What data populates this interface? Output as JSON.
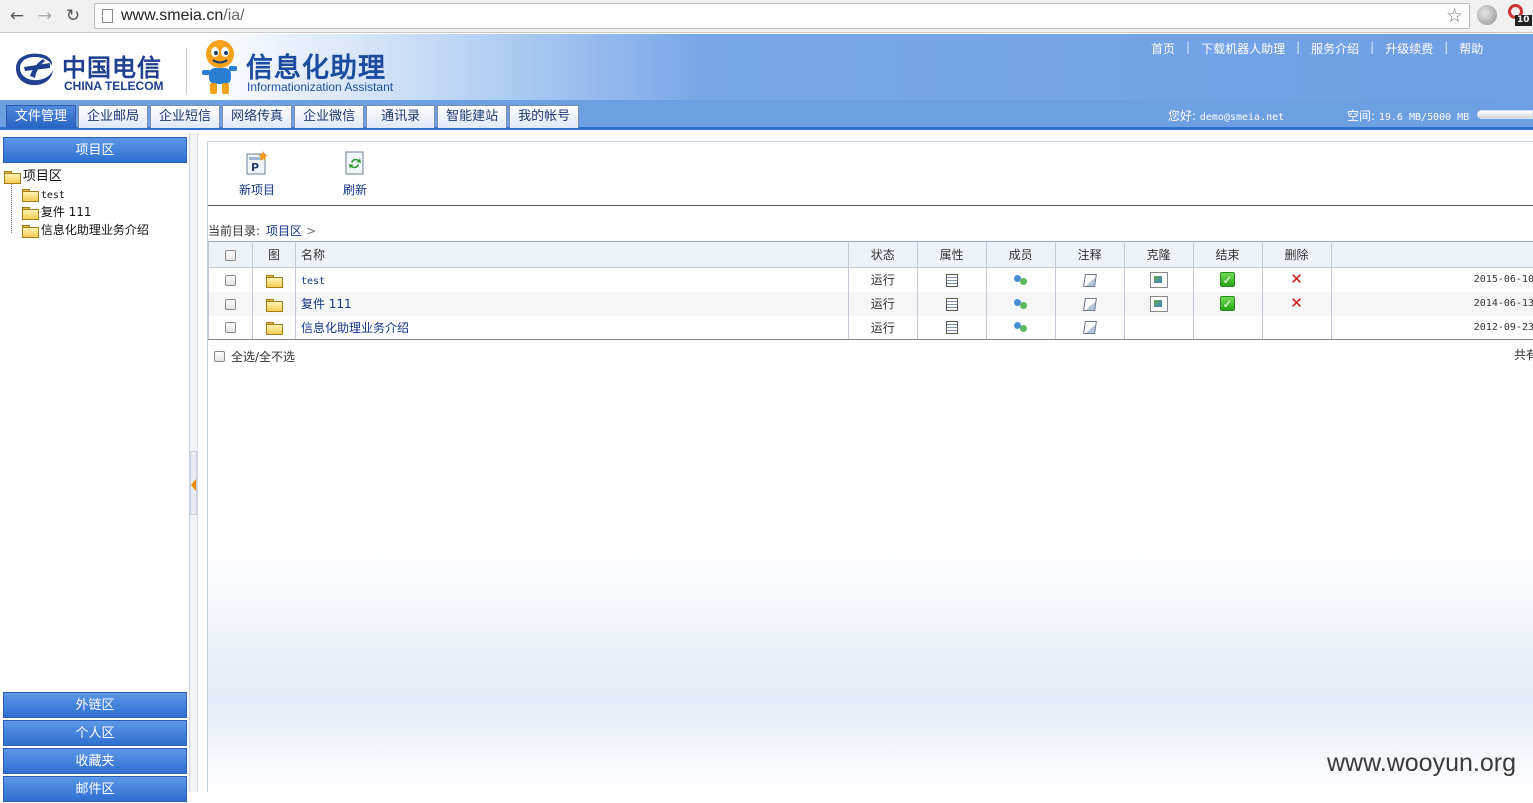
{
  "browser": {
    "url_host": "www.smeia.cn",
    "url_path": "/ia/",
    "ext_badge_count": "10"
  },
  "brand": {
    "telecom_cn": "中国电信",
    "telecom_en": "CHINA TELECOM",
    "product_cn": "信息化助理",
    "product_en": "Informationization Assistant",
    "telecom_color": "#1f3f8f",
    "product_color": "#1d4c9e"
  },
  "toplinks": [
    {
      "label": "首页"
    },
    {
      "label": "下载机器人助理"
    },
    {
      "label": "服务介绍"
    },
    {
      "label": "升级续费"
    },
    {
      "label": "帮助"
    }
  ],
  "tabs": [
    {
      "label": "文件管理",
      "active": true
    },
    {
      "label": "企业邮局"
    },
    {
      "label": "企业短信"
    },
    {
      "label": "网络传真"
    },
    {
      "label": "企业微信"
    },
    {
      "label": "通讯录"
    },
    {
      "label": "智能建站"
    },
    {
      "label": "我的帐号"
    }
  ],
  "user": {
    "greeting_label": "您好:",
    "email": "demo@smeia.net",
    "space_label": "空间:",
    "space_value": "19.6 MB/5000 MB"
  },
  "sidebar": {
    "top_section": "项目区",
    "tree_root": "项目区",
    "tree_items": [
      {
        "label": "test"
      },
      {
        "label": "复件 111"
      },
      {
        "label": "信息化助理业务介绍"
      }
    ],
    "bottom_sections": [
      {
        "label": "外链区"
      },
      {
        "label": "个人区"
      },
      {
        "label": "收藏夹"
      },
      {
        "label": "邮件区"
      }
    ]
  },
  "toolbar": {
    "new_label": "新项目",
    "refresh_label": "刷新"
  },
  "breadcrumb": {
    "prefix": "当前目录:",
    "current": "项目区",
    "separator": ">"
  },
  "table": {
    "headers": {
      "icon": "图",
      "name": "名称",
      "status": "状态",
      "props": "属性",
      "members": "成员",
      "notes": "注释",
      "clone": "克隆",
      "end": "结束",
      "delete": "删除"
    },
    "rows": [
      {
        "name": "test",
        "status": "运行",
        "date": "2015-06-10",
        "has_clone": true,
        "has_end": true,
        "has_delete": true
      },
      {
        "name": "复件 111",
        "status": "运行",
        "date": "2014-06-13",
        "has_clone": true,
        "has_end": true,
        "has_delete": true
      },
      {
        "name": "信息化助理业务介绍",
        "status": "运行",
        "date": "2012-09-23",
        "has_clone": false,
        "has_end": false,
        "has_delete": false
      }
    ]
  },
  "footer": {
    "select_all_label": "全选/全不选",
    "total_label": "共有"
  },
  "watermark": "www.wooyun.org",
  "colors": {
    "header_blue": "#6d9fe3",
    "tab_active": "#2864c6",
    "link_blue": "#12358b",
    "delete_red": "#d11515",
    "check_green": "#2aa51b"
  }
}
